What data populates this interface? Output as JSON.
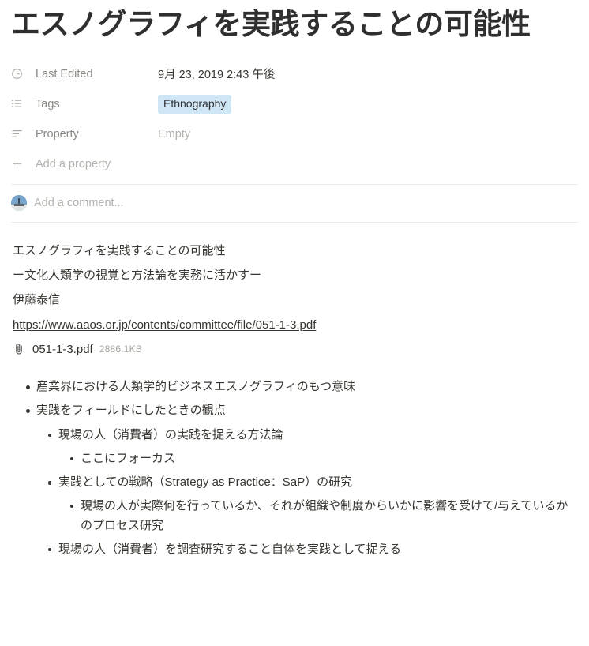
{
  "page": {
    "title": "エスノグラフィを実践することの可能性"
  },
  "properties": {
    "rows": [
      {
        "icon": "clock-icon",
        "label": "Last Edited",
        "value": "9月 23, 2019 2:43 午後",
        "type": "date"
      },
      {
        "icon": "bulleted-list-icon",
        "label": "Tags",
        "value": "Ethnography",
        "type": "tag"
      },
      {
        "icon": "text-lines-icon",
        "label": "Property",
        "value": "Empty",
        "type": "empty"
      }
    ],
    "add_property_label": "Add a property",
    "add_property_icon": "plus-icon",
    "tag_background_color": "#cfe6f7",
    "tag_text_color": "#2f2f2f"
  },
  "comment": {
    "placeholder": "Add a comment...",
    "avatar_name": "user-avatar"
  },
  "content": {
    "paragraphs": [
      "エスノグラフィを実践することの可能性",
      "ー文化人類学の視覚と方法論を実務に活かすー",
      "伊藤泰信"
    ],
    "link": {
      "text": "https://www.aaos.or.jp/contents/committee/file/051-1-3.pdf",
      "underline": true
    },
    "attachment": {
      "icon": "paperclip-icon",
      "name": "051-1-3.pdf",
      "size": "2886.1KB"
    },
    "bullets": [
      {
        "level": 1,
        "text": "産業界における人類学的ビジネスエスノグラフィのもつ意味"
      },
      {
        "level": 1,
        "text": "実践をフィールドにしたときの観点"
      },
      {
        "level": 2,
        "text": "現場の人（消費者）の実践を捉える方法論"
      },
      {
        "level": 3,
        "text": "ここにフォーカス"
      },
      {
        "level": 2,
        "text": "実践としての戦略（Strategy as Practice：SaP）の研究"
      },
      {
        "level": 3,
        "text": "現場の人が実際何を行っているか、それが組織や制度からいかに影響を受けて/与えているかのプロセス研究"
      },
      {
        "level": 2,
        "text": "現場の人（消費者）を調査研究すること自体を実践として捉える"
      }
    ]
  }
}
